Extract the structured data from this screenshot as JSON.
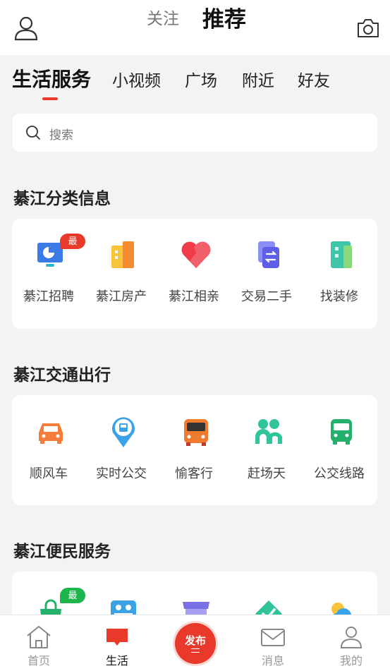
{
  "top_tabs": {
    "follow": "关注",
    "recommend": "推荐"
  },
  "sub_tabs": [
    "生活服务",
    "小视频",
    "广场",
    "附近",
    "好友"
  ],
  "search": {
    "placeholder": "搜索"
  },
  "sections": [
    {
      "title": "綦江分类信息",
      "items": [
        {
          "label": "綦江招聘",
          "icon": "recruit-icon",
          "badge": "最热"
        },
        {
          "label": "綦江房产",
          "icon": "building-icon"
        },
        {
          "label": "綦江相亲",
          "icon": "heart-icon"
        },
        {
          "label": "交易二手",
          "icon": "trade-icon"
        },
        {
          "label": "找装修",
          "icon": "renovation-icon"
        }
      ]
    },
    {
      "title": "綦江交通出行",
      "items": [
        {
          "label": "顺风车",
          "icon": "car-icon"
        },
        {
          "label": "实时公交",
          "icon": "bus-location-icon"
        },
        {
          "label": "愉客行",
          "icon": "coach-bus-icon"
        },
        {
          "label": "赶场天",
          "icon": "people-icon"
        },
        {
          "label": "公交线路",
          "icon": "bus-route-icon"
        }
      ]
    },
    {
      "title": "綦江便民服务",
      "items": [
        {
          "label": "",
          "icon": "bag-icon",
          "badge": "最新"
        },
        {
          "label": "",
          "icon": "id-card-icon"
        },
        {
          "label": "",
          "icon": "shop-icon"
        },
        {
          "label": "",
          "icon": "check-icon"
        },
        {
          "label": "",
          "icon": "weather-icon"
        }
      ]
    }
  ],
  "bottom_nav": {
    "home": "首页",
    "life": "生活",
    "publish": "发布",
    "messages": "消息",
    "mine": "我的"
  },
  "colors": {
    "accent": "#e8392a",
    "badge_hot": "#e8392a",
    "badge_new": "#1db64d"
  }
}
